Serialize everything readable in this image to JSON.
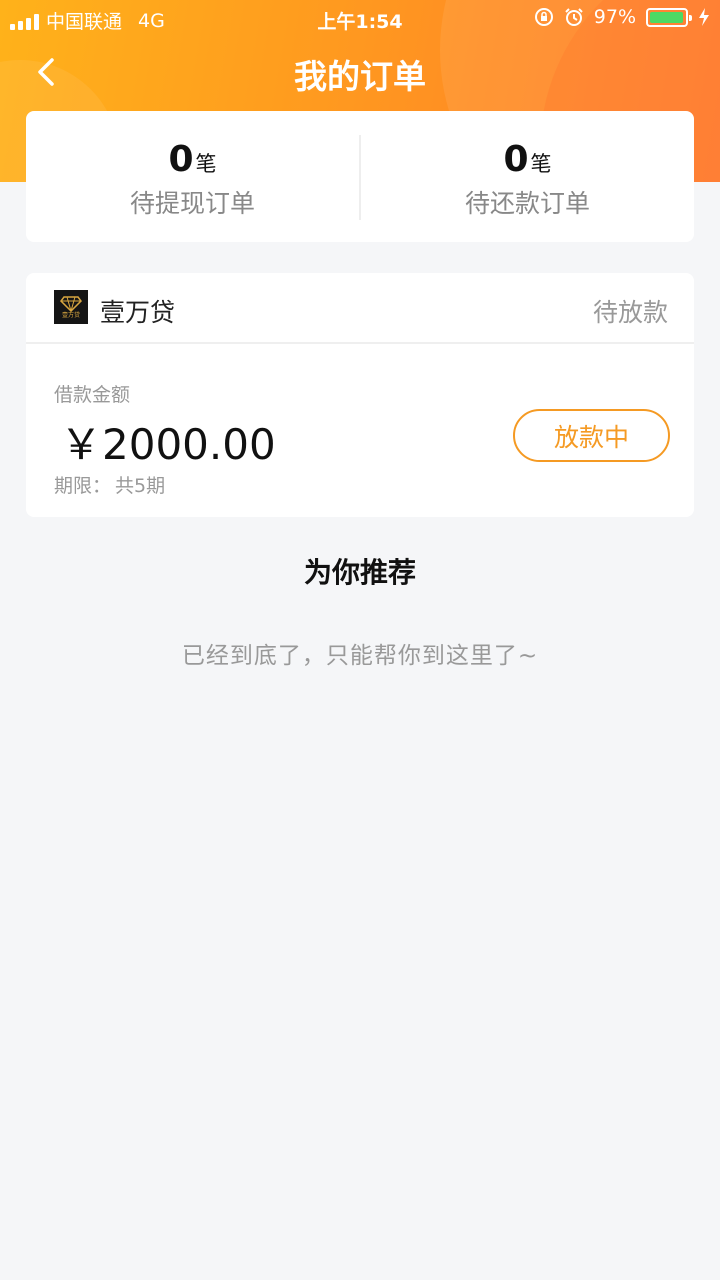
{
  "status_bar": {
    "carrier": "中国联通",
    "network": "4G",
    "time": "上午1:54",
    "battery": "97%",
    "battery_level": 0.97,
    "icons": [
      "signal-icon",
      "rotation-lock-icon",
      "alarm-icon",
      "battery-icon",
      "charging-icon"
    ]
  },
  "nav": {
    "title": "我的订单",
    "back_icon": "chevron-left-icon"
  },
  "summary": {
    "items": [
      {
        "count": "0",
        "unit": "笔",
        "label": "待提现订单"
      },
      {
        "count": "0",
        "unit": "笔",
        "label": "待还款订单"
      }
    ]
  },
  "order": {
    "brand": "壹万贷",
    "brand_logo_text": "壹万贷",
    "status": "待放款",
    "amount_label": "借款金额",
    "amount": "￥2000.00",
    "term_label": "期限：",
    "term_value": "共5期",
    "action": "放款中"
  },
  "recommend": {
    "title": "为你推荐",
    "end_hint": "已经到底了，只能帮你到这里了~"
  },
  "colors": {
    "header_start": "#ffb21a",
    "header_end": "#ff7a2a",
    "accent": "#f59a23",
    "background": "#f5f6f8",
    "battery_green": "#4cd964"
  }
}
